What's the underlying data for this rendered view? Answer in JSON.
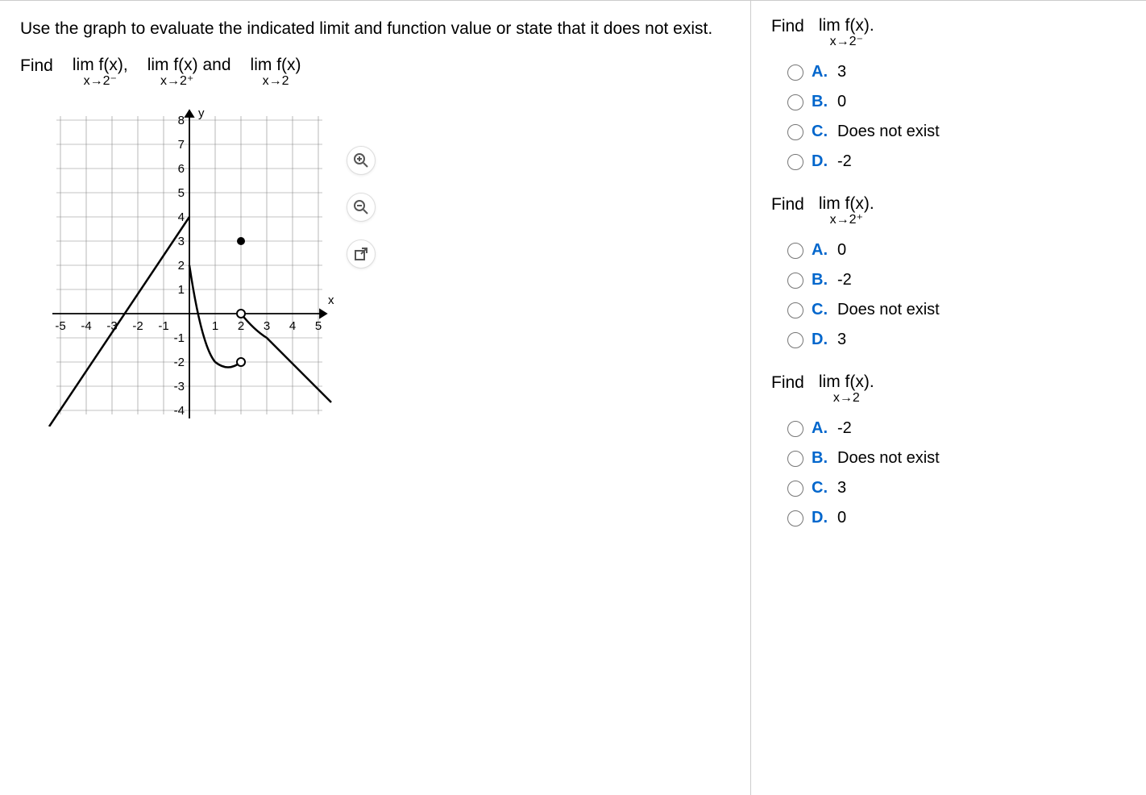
{
  "instruction": "Use the graph to evaluate the indicated limit and function value or state that it does not exist.",
  "find_limits": {
    "prefix": "Find",
    "lim1_top": "lim  f(x),",
    "lim1_bottom": "x→2⁻",
    "lim2_top": "lim  f(x) and",
    "lim2_bottom": "x→2⁺",
    "lim3_top": "lim f(x)",
    "lim3_bottom": "x→2"
  },
  "toolbar": {
    "zoom_in": "zoom-in-icon",
    "zoom_out": "zoom-out-icon",
    "popout": "popout-icon"
  },
  "questions": [
    {
      "prompt_prefix": "Find",
      "lim_top": "lim  f(x).",
      "lim_bottom": "x→2⁻",
      "options": [
        {
          "letter": "A.",
          "value": "3"
        },
        {
          "letter": "B.",
          "value": "0"
        },
        {
          "letter": "C.",
          "value": "Does not exist"
        },
        {
          "letter": "D.",
          "value": "-2"
        }
      ]
    },
    {
      "prompt_prefix": "Find",
      "lim_top": "lim  f(x).",
      "lim_bottom": "x→2⁺",
      "options": [
        {
          "letter": "A.",
          "value": "0"
        },
        {
          "letter": "B.",
          "value": "-2"
        },
        {
          "letter": "C.",
          "value": "Does not exist"
        },
        {
          "letter": "D.",
          "value": "3"
        }
      ]
    },
    {
      "prompt_prefix": "Find",
      "lim_top": "lim f(x).",
      "lim_bottom": "x→2",
      "options": [
        {
          "letter": "A.",
          "value": "-2"
        },
        {
          "letter": "B.",
          "value": "Does not exist"
        },
        {
          "letter": "C.",
          "value": "3"
        },
        {
          "letter": "D.",
          "value": "0"
        }
      ]
    }
  ],
  "chart_data": {
    "type": "line",
    "xlabel": "x",
    "ylabel": "y",
    "xlim": [
      -5,
      5
    ],
    "ylim": [
      -4,
      8
    ],
    "x_ticks": [
      -5,
      -4,
      -3,
      -2,
      -1,
      1,
      2,
      3,
      4,
      5
    ],
    "y_ticks": [
      -4,
      -3,
      -2,
      -1,
      1,
      2,
      3,
      4,
      5,
      6,
      7,
      8
    ],
    "series": [
      {
        "name": "left-branch",
        "description": "line segment approaching (0,4) from lower-left",
        "points": [
          [
            -5.5,
            -5
          ],
          [
            0,
            4
          ]
        ]
      },
      {
        "name": "right-branch",
        "description": "curve starting near (0,2) going down through minimum near x=2 then up",
        "points": [
          [
            0,
            2
          ],
          [
            0.5,
            -1
          ],
          [
            1,
            -2
          ],
          [
            2,
            -2
          ],
          [
            2,
            0
          ],
          [
            2.5,
            -0.5
          ],
          [
            3,
            -1
          ],
          [
            4,
            -2
          ],
          [
            5,
            -3
          ],
          [
            5.5,
            -3.5
          ]
        ]
      }
    ],
    "markers": [
      {
        "x": 2,
        "y": 0,
        "type": "open-circle"
      },
      {
        "x": 2,
        "y": -2,
        "type": "open-circle"
      },
      {
        "x": 2,
        "y": 3,
        "type": "closed-circle"
      }
    ]
  }
}
